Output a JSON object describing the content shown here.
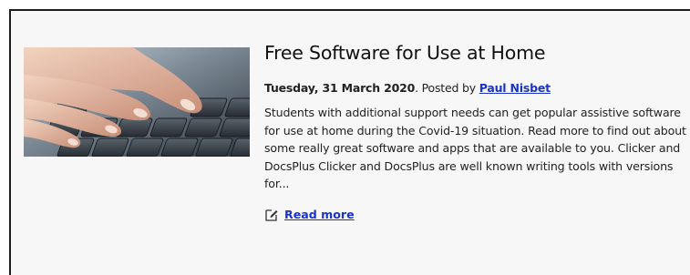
{
  "post": {
    "title": "Free Software for Use at Home",
    "date": "Tuesday, 31 March 2020",
    "posted_by_prefix": ". Posted by ",
    "author": "Paul Nisbet",
    "excerpt_lines": [
      "Students with additional support needs can get popular assistive software",
      "for use at home during the Covid-19 situation. Read more to find out about",
      "some really great software and apps that are available to you. Clicker and",
      "DocsPlus Clicker and DocsPlus are well known writing tools with versions",
      "for..."
    ],
    "read_more_label": "Read more",
    "read_more_icon": "edit-icon",
    "thumbnail_icon": "keyboard-typing-image"
  }
}
